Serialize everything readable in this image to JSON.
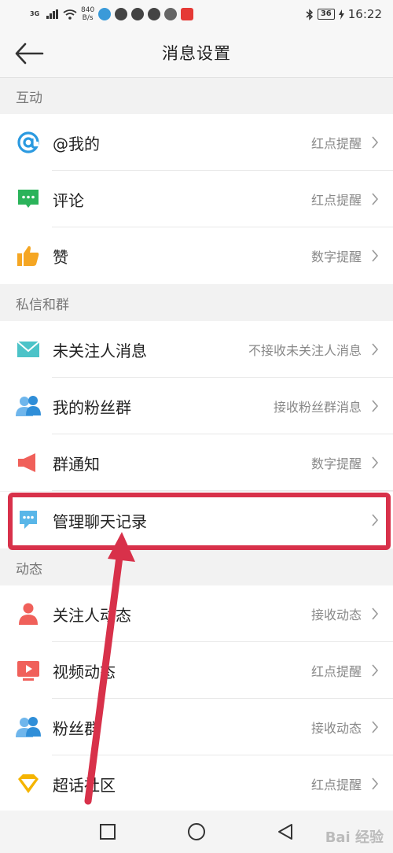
{
  "status_bar": {
    "network": "3G",
    "speed": "840",
    "speed_unit": "B/s",
    "battery": "36",
    "time": "16:22"
  },
  "header": {
    "title": "消息设置"
  },
  "sections": [
    {
      "title": "互动",
      "items": [
        {
          "icon": "at-icon",
          "label": "@我的",
          "value": "红点提醒"
        },
        {
          "icon": "comment-icon",
          "label": "评论",
          "value": "红点提醒"
        },
        {
          "icon": "thumbs-up-icon",
          "label": "赞",
          "value": "数字提醒"
        }
      ]
    },
    {
      "title": "私信和群",
      "items": [
        {
          "icon": "mail-icon",
          "label": "未关注人消息",
          "value": "不接收未关注人消息"
        },
        {
          "icon": "fans-group-icon",
          "label": "我的粉丝群",
          "value": "接收粉丝群消息"
        },
        {
          "icon": "megaphone-icon",
          "label": "群通知",
          "value": "数字提醒"
        },
        {
          "icon": "chat-record-icon",
          "label": "管理聊天记录",
          "value": ""
        }
      ]
    },
    {
      "title": "动态",
      "items": [
        {
          "icon": "person-icon",
          "label": "关注人动态",
          "value": "接收动态"
        },
        {
          "icon": "video-icon",
          "label": "视频动态",
          "value": "红点提醒"
        },
        {
          "icon": "group-icon",
          "label": "粉丝群",
          "value": "接收动态"
        },
        {
          "icon": "diamond-icon",
          "label": "超话社区",
          "value": "红点提醒"
        }
      ]
    }
  ],
  "watermark": "Bai 经验",
  "colors": {
    "highlight": "#d8314a",
    "at": "#2b9ae0",
    "comment": "#2bb35a",
    "like": "#f5a623",
    "mail": "#4cc3c8",
    "megaphone": "#f0605a"
  }
}
